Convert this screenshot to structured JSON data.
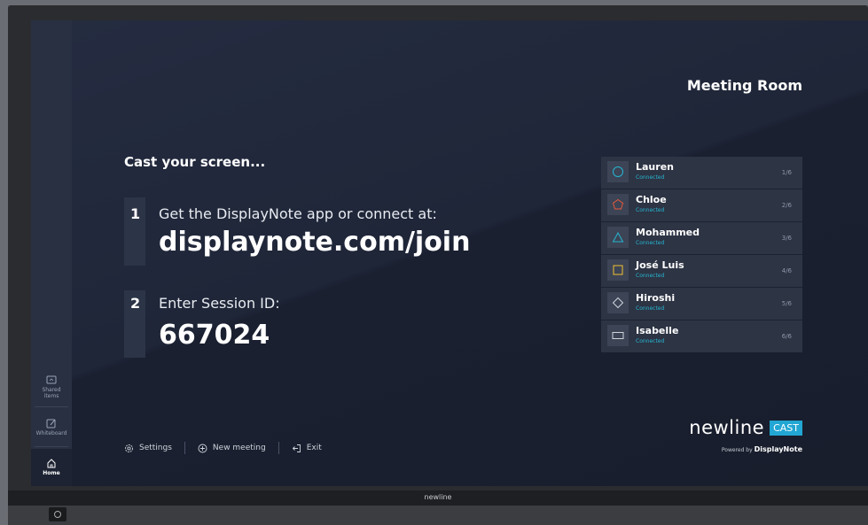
{
  "sidebar": {
    "items": [
      {
        "label_line1": "Shared",
        "label_line2": "items",
        "icon": "folder-icon"
      },
      {
        "label": "Whiteboard",
        "icon": "edit-icon"
      },
      {
        "label": "Home",
        "icon": "home-icon"
      }
    ]
  },
  "header": {
    "room_name": "Meeting Room"
  },
  "main": {
    "heading": "Cast your screen...",
    "step1": {
      "number": "1",
      "text": "Get the DisplayNote app or connect at:",
      "value": "displaynote.com/join"
    },
    "step2": {
      "number": "2",
      "text": "Enter Session ID:",
      "value": "667024"
    }
  },
  "participants": [
    {
      "name": "Lauren",
      "status": "Connected",
      "count": "1/6",
      "shape": "circle-icon",
      "color": "#26b5d1"
    },
    {
      "name": "Chloe",
      "status": "Connected",
      "count": "2/6",
      "shape": "pentagon-icon",
      "color": "#e85a3c"
    },
    {
      "name": "Mohammed",
      "status": "Connected",
      "count": "3/6",
      "shape": "triangle-icon",
      "color": "#26b5d1"
    },
    {
      "name": "José Luis",
      "status": "Connected",
      "count": "4/6",
      "shape": "square-icon",
      "color": "#f2c12e"
    },
    {
      "name": "Hiroshi",
      "status": "Connected",
      "count": "5/6",
      "shape": "diamond-icon",
      "color": "#d0d4dc"
    },
    {
      "name": "Isabelle",
      "status": "Connected",
      "count": "6/6",
      "shape": "rectangle-icon",
      "color": "#d0d4dc"
    }
  ],
  "footer": {
    "settings": "Settings",
    "new_meeting": "New meeting",
    "exit": "Exit"
  },
  "brand": {
    "name": "newline",
    "product": "CAST",
    "powered_prefix": "Powered by",
    "powered_brand": "DisplayNote"
  },
  "device": {
    "bezel_logo": "newline"
  },
  "colors": {
    "accent": "#26b5d1",
    "background": "#1f2638"
  }
}
